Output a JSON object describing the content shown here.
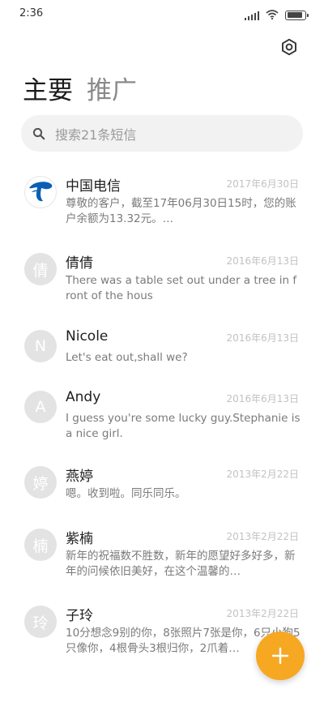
{
  "status_bar": {
    "time": "2:36",
    "icons": [
      "signal-icon",
      "wifi-icon",
      "battery-icon"
    ],
    "battery_level": 0.9
  },
  "header": {
    "settings_icon": "settings-icon",
    "tabs": [
      {
        "label": "主要",
        "active": true
      },
      {
        "label": "推广",
        "active": false
      }
    ]
  },
  "search": {
    "icon": "search-icon",
    "placeholder": "搜索21条短信"
  },
  "messages": [
    {
      "avatar": "",
      "avatar_icon": "china-telecom-logo",
      "sender": "中国电信",
      "date": "2017年6月30日",
      "preview": "尊敬的客户，截至17年06月30日15时，您的账户余额为13.32元。…"
    },
    {
      "avatar": "倩",
      "sender": "倩倩",
      "date": "2016年6月13日",
      "preview": "There was a table set out under a tree in front of the hous"
    },
    {
      "avatar": "N",
      "sender": "Nicole",
      "date": "2016年6月13日",
      "preview": "Let's eat out,shall we?"
    },
    {
      "avatar": "A",
      "sender": "Andy",
      "date": "2016年6月13日",
      "preview": "I guess you're some lucky guy.Stephanie is a nice girl."
    },
    {
      "avatar": "婷",
      "sender": "燕婷",
      "date": "2013年2月22日",
      "preview": "嗯。收到啦。同乐同乐。"
    },
    {
      "avatar": "楠",
      "sender": "紫楠",
      "date": "2013年2月22日",
      "preview": "新年的祝福数不胜数，新年的愿望好多好多，新年的问候依旧美好，在这个温馨的…"
    },
    {
      "avatar": "玲",
      "sender": "子玲",
      "date": "2013年2月22日",
      "preview": "10分想念9别的你，8张照片7张是你，6只小狗5只像你，4根骨头3根归你，2爪着…"
    }
  ],
  "fab": {
    "icon": "plus-icon"
  },
  "colors": {
    "accent": "#f6a823",
    "avatar_bg": "#e3e3e3",
    "telecom_blue": "#0b5fb5"
  }
}
